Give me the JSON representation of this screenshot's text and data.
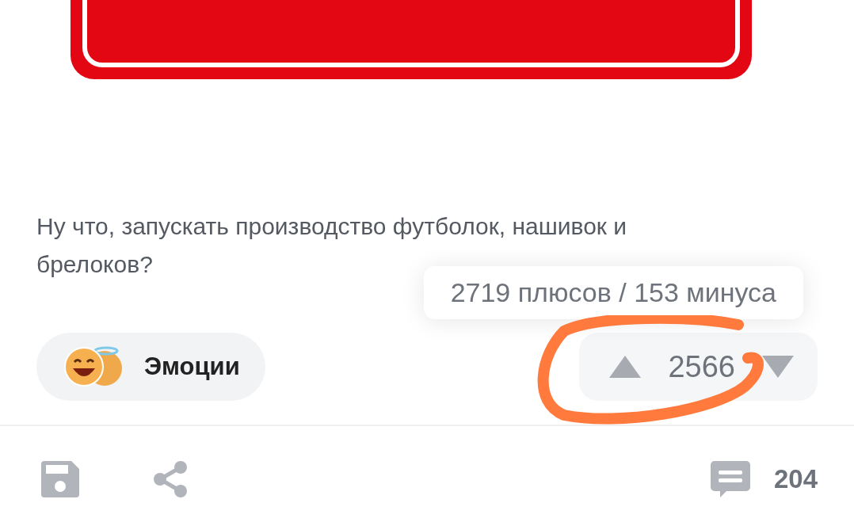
{
  "post": {
    "text": "Ну что, запускать производство футболок, нашивок и брелоков?"
  },
  "rating": {
    "tooltip": "2719 плюсов / 153 минуса",
    "score": "2566"
  },
  "emotions": {
    "label": "Эмоции"
  },
  "footer": {
    "comments_count": "204"
  }
}
